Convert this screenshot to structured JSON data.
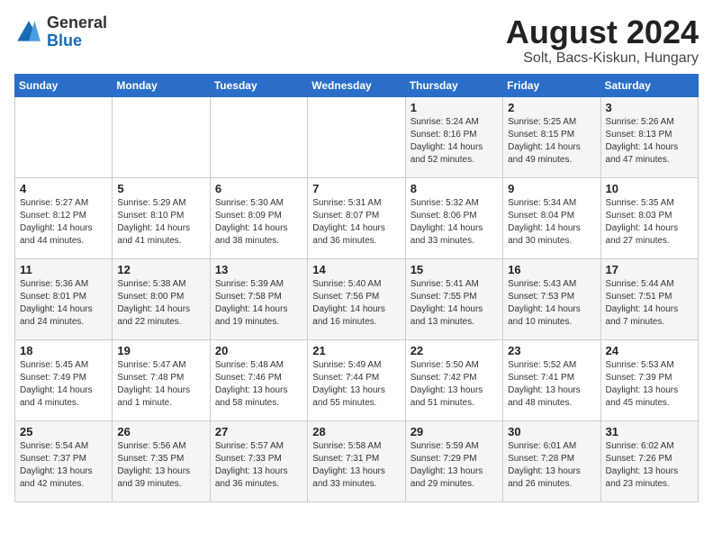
{
  "logo": {
    "general": "General",
    "blue": "Blue"
  },
  "title": {
    "month_year": "August 2024",
    "location": "Solt, Bacs-Kiskun, Hungary"
  },
  "days_header": [
    "Sunday",
    "Monday",
    "Tuesday",
    "Wednesday",
    "Thursday",
    "Friday",
    "Saturday"
  ],
  "weeks": [
    [
      {
        "day": "",
        "details": ""
      },
      {
        "day": "",
        "details": ""
      },
      {
        "day": "",
        "details": ""
      },
      {
        "day": "",
        "details": ""
      },
      {
        "day": "1",
        "details": "Sunrise: 5:24 AM\nSunset: 8:16 PM\nDaylight: 14 hours\nand 52 minutes."
      },
      {
        "day": "2",
        "details": "Sunrise: 5:25 AM\nSunset: 8:15 PM\nDaylight: 14 hours\nand 49 minutes."
      },
      {
        "day": "3",
        "details": "Sunrise: 5:26 AM\nSunset: 8:13 PM\nDaylight: 14 hours\nand 47 minutes."
      }
    ],
    [
      {
        "day": "4",
        "details": "Sunrise: 5:27 AM\nSunset: 8:12 PM\nDaylight: 14 hours\nand 44 minutes."
      },
      {
        "day": "5",
        "details": "Sunrise: 5:29 AM\nSunset: 8:10 PM\nDaylight: 14 hours\nand 41 minutes."
      },
      {
        "day": "6",
        "details": "Sunrise: 5:30 AM\nSunset: 8:09 PM\nDaylight: 14 hours\nand 38 minutes."
      },
      {
        "day": "7",
        "details": "Sunrise: 5:31 AM\nSunset: 8:07 PM\nDaylight: 14 hours\nand 36 minutes."
      },
      {
        "day": "8",
        "details": "Sunrise: 5:32 AM\nSunset: 8:06 PM\nDaylight: 14 hours\nand 33 minutes."
      },
      {
        "day": "9",
        "details": "Sunrise: 5:34 AM\nSunset: 8:04 PM\nDaylight: 14 hours\nand 30 minutes."
      },
      {
        "day": "10",
        "details": "Sunrise: 5:35 AM\nSunset: 8:03 PM\nDaylight: 14 hours\nand 27 minutes."
      }
    ],
    [
      {
        "day": "11",
        "details": "Sunrise: 5:36 AM\nSunset: 8:01 PM\nDaylight: 14 hours\nand 24 minutes."
      },
      {
        "day": "12",
        "details": "Sunrise: 5:38 AM\nSunset: 8:00 PM\nDaylight: 14 hours\nand 22 minutes."
      },
      {
        "day": "13",
        "details": "Sunrise: 5:39 AM\nSunset: 7:58 PM\nDaylight: 14 hours\nand 19 minutes."
      },
      {
        "day": "14",
        "details": "Sunrise: 5:40 AM\nSunset: 7:56 PM\nDaylight: 14 hours\nand 16 minutes."
      },
      {
        "day": "15",
        "details": "Sunrise: 5:41 AM\nSunset: 7:55 PM\nDaylight: 14 hours\nand 13 minutes."
      },
      {
        "day": "16",
        "details": "Sunrise: 5:43 AM\nSunset: 7:53 PM\nDaylight: 14 hours\nand 10 minutes."
      },
      {
        "day": "17",
        "details": "Sunrise: 5:44 AM\nSunset: 7:51 PM\nDaylight: 14 hours\nand 7 minutes."
      }
    ],
    [
      {
        "day": "18",
        "details": "Sunrise: 5:45 AM\nSunset: 7:49 PM\nDaylight: 14 hours\nand 4 minutes."
      },
      {
        "day": "19",
        "details": "Sunrise: 5:47 AM\nSunset: 7:48 PM\nDaylight: 14 hours\nand 1 minute."
      },
      {
        "day": "20",
        "details": "Sunrise: 5:48 AM\nSunset: 7:46 PM\nDaylight: 13 hours\nand 58 minutes."
      },
      {
        "day": "21",
        "details": "Sunrise: 5:49 AM\nSunset: 7:44 PM\nDaylight: 13 hours\nand 55 minutes."
      },
      {
        "day": "22",
        "details": "Sunrise: 5:50 AM\nSunset: 7:42 PM\nDaylight: 13 hours\nand 51 minutes."
      },
      {
        "day": "23",
        "details": "Sunrise: 5:52 AM\nSunset: 7:41 PM\nDaylight: 13 hours\nand 48 minutes."
      },
      {
        "day": "24",
        "details": "Sunrise: 5:53 AM\nSunset: 7:39 PM\nDaylight: 13 hours\nand 45 minutes."
      }
    ],
    [
      {
        "day": "25",
        "details": "Sunrise: 5:54 AM\nSunset: 7:37 PM\nDaylight: 13 hours\nand 42 minutes."
      },
      {
        "day": "26",
        "details": "Sunrise: 5:56 AM\nSunset: 7:35 PM\nDaylight: 13 hours\nand 39 minutes."
      },
      {
        "day": "27",
        "details": "Sunrise: 5:57 AM\nSunset: 7:33 PM\nDaylight: 13 hours\nand 36 minutes."
      },
      {
        "day": "28",
        "details": "Sunrise: 5:58 AM\nSunset: 7:31 PM\nDaylight: 13 hours\nand 33 minutes."
      },
      {
        "day": "29",
        "details": "Sunrise: 5:59 AM\nSunset: 7:29 PM\nDaylight: 13 hours\nand 29 minutes."
      },
      {
        "day": "30",
        "details": "Sunrise: 6:01 AM\nSunset: 7:28 PM\nDaylight: 13 hours\nand 26 minutes."
      },
      {
        "day": "31",
        "details": "Sunrise: 6:02 AM\nSunset: 7:26 PM\nDaylight: 13 hours\nand 23 minutes."
      }
    ]
  ]
}
